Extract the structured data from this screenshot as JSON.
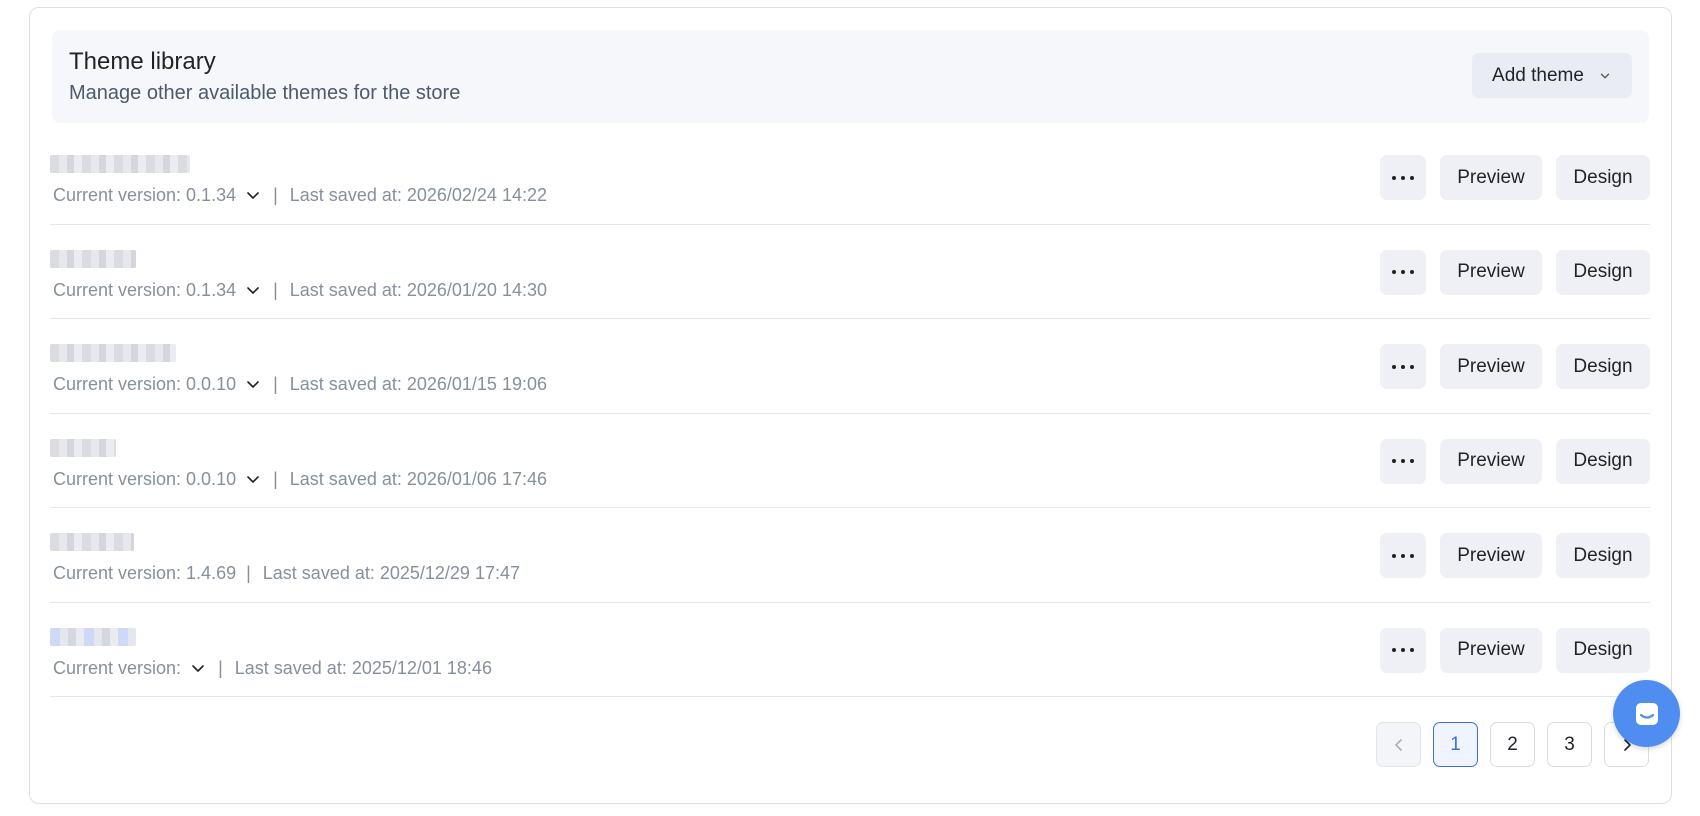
{
  "header": {
    "title": "Theme library",
    "subtitle": "Manage other available themes for the store",
    "add_button_label": "Add theme"
  },
  "themes": [
    {
      "version_label": "Current version: 0.1.34",
      "has_version_dropdown": true,
      "sep": "|",
      "saved": "Last saved at: 2026/02/24 14:22",
      "more": "···",
      "preview": "Preview",
      "design": "Design"
    },
    {
      "version_label": "Current version: 0.1.34",
      "has_version_dropdown": true,
      "sep": "|",
      "saved": "Last saved at: 2026/01/20 14:30",
      "more": "···",
      "preview": "Preview",
      "design": "Design"
    },
    {
      "version_label": "Current version: 0.0.10",
      "has_version_dropdown": true,
      "sep": "|",
      "saved": "Last saved at: 2026/01/15 19:06",
      "more": "···",
      "preview": "Preview",
      "design": "Design"
    },
    {
      "version_label": "Current version: 0.0.10",
      "has_version_dropdown": true,
      "sep": "|",
      "saved": "Last saved at: 2026/01/06 17:46",
      "more": "···",
      "preview": "Preview",
      "design": "Design"
    },
    {
      "version_label": "Current version: 1.4.69",
      "has_version_dropdown": false,
      "sep": "|",
      "saved": "Last saved at: 2025/12/29 17:47",
      "more": "···",
      "preview": "Preview",
      "design": "Design"
    },
    {
      "version_label": "Current version:",
      "has_version_dropdown": true,
      "sep": "|",
      "saved": "Last saved at: 2025/12/01 18:46",
      "more": "···",
      "preview": "Preview",
      "design": "Design"
    }
  ],
  "pagination": {
    "pages": [
      "1",
      "2",
      "3"
    ],
    "current": "1"
  },
  "icons": {
    "add_chevron": "chevron-down-icon",
    "version_chevron": "chevron-down-icon",
    "prev": "chevron-left-icon",
    "next": "chevron-right-icon",
    "more": "ellipsis-icon",
    "chat": "chat-icon"
  },
  "colors": {
    "accent": "#3c6fe6",
    "chat_bubble": "#4f8ef0",
    "muted_text": "#86909c",
    "button_bg": "#eef0f5"
  }
}
